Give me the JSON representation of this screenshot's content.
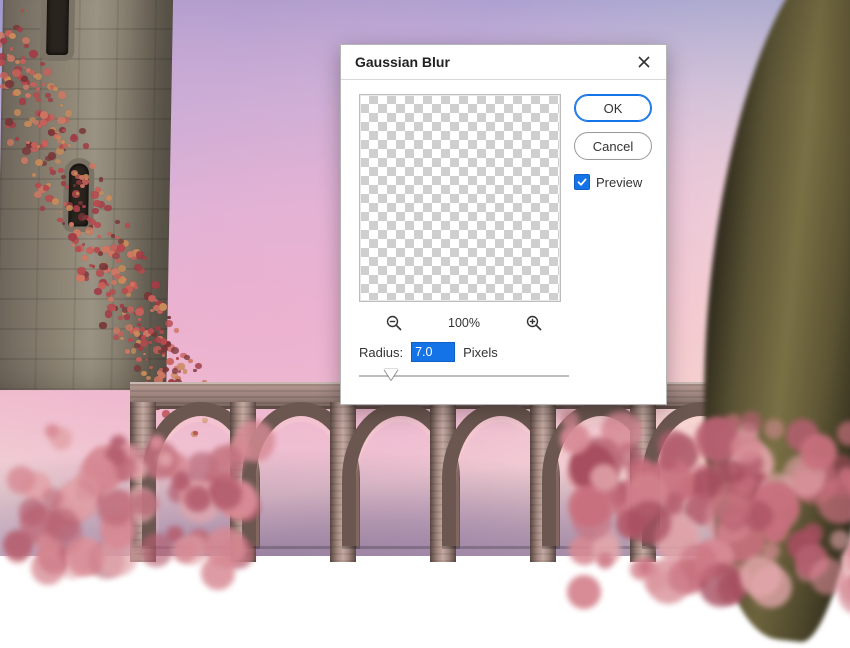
{
  "dialog": {
    "title": "Gaussian Blur",
    "ok_label": "OK",
    "cancel_label": "Cancel",
    "preview_label": "Preview",
    "preview_checked": true,
    "zoom_percent": "100%",
    "radius_label": "Radius:",
    "radius_value": "7.0",
    "radius_unit": "Pixels",
    "slider_fraction": 0.15
  },
  "icons": {
    "close": "close-icon",
    "zoom_out": "zoom-out-icon",
    "zoom_in": "zoom-in-icon",
    "check": "checkmark-icon"
  }
}
